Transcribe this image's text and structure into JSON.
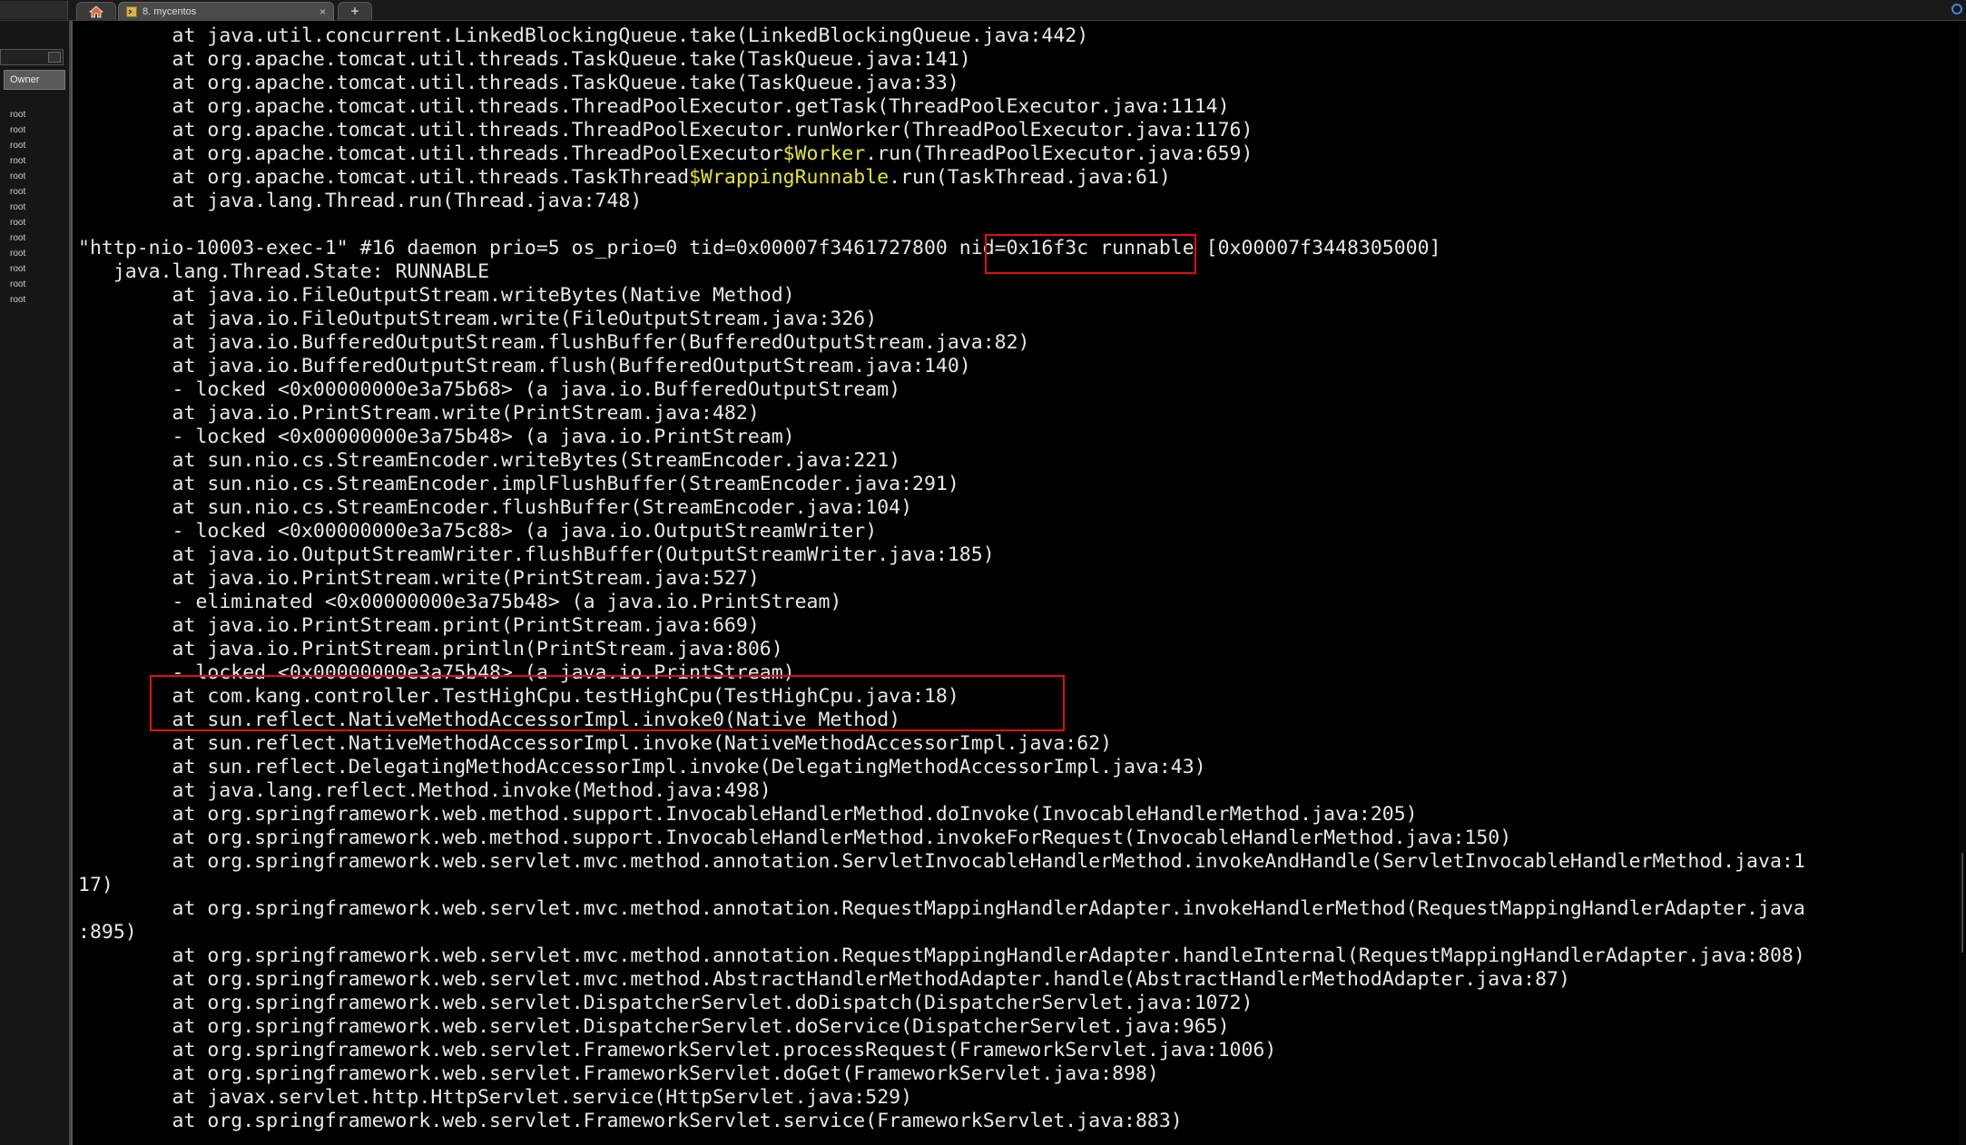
{
  "tabs": {
    "home_icon": "home-icon",
    "session_label": "8. mycentos",
    "session_icon": "terminal-session-icon",
    "close_glyph": "×",
    "new_tab_glyph": "+"
  },
  "sidebar": {
    "column_header": "Owner",
    "rows": [
      "root",
      "root",
      "root",
      "root",
      "root",
      "root",
      "root",
      "root",
      "root",
      "root",
      "root",
      "root",
      "root"
    ]
  },
  "colors": {
    "background": "#000000",
    "text": "#e8e8e8",
    "highlight_text": "#e6e62a",
    "annotation_box": "#e01010"
  },
  "terminal": {
    "lines": [
      {
        "text": "        at java.util.concurrent.LinkedBlockingQueue.take(LinkedBlockingQueue.java:442)"
      },
      {
        "text": "        at org.apache.tomcat.util.threads.TaskQueue.take(TaskQueue.java:141)"
      },
      {
        "text": "        at org.apache.tomcat.util.threads.TaskQueue.take(TaskQueue.java:33)"
      },
      {
        "text": "        at org.apache.tomcat.util.threads.ThreadPoolExecutor.getTask(ThreadPoolExecutor.java:1114)"
      },
      {
        "text": "        at org.apache.tomcat.util.threads.ThreadPoolExecutor.runWorker(ThreadPoolExecutor.java:1176)"
      },
      {
        "before": "        at org.apache.tomcat.util.threads.ThreadPoolExecutor",
        "hl": "$Worker",
        "after": ".run(ThreadPoolExecutor.java:659)"
      },
      {
        "before": "        at org.apache.tomcat.util.threads.TaskThread",
        "hl": "$WrappingRunnable",
        "after": ".run(TaskThread.java:61)"
      },
      {
        "text": "        at java.lang.Thread.run(Thread.java:748)"
      },
      {
        "text": ""
      },
      {
        "text": "\"http-nio-10003-exec-1\" #16 daemon prio=5 os_prio=0 tid=0x00007f3461727800 nid=0x16f3c runnable [0x00007f3448305000]"
      },
      {
        "text": "   java.lang.Thread.State: RUNNABLE"
      },
      {
        "text": "        at java.io.FileOutputStream.writeBytes(Native Method)"
      },
      {
        "text": "        at java.io.FileOutputStream.write(FileOutputStream.java:326)"
      },
      {
        "text": "        at java.io.BufferedOutputStream.flushBuffer(BufferedOutputStream.java:82)"
      },
      {
        "text": "        at java.io.BufferedOutputStream.flush(BufferedOutputStream.java:140)"
      },
      {
        "text": "        - locked <0x00000000e3a75b68> (a java.io.BufferedOutputStream)"
      },
      {
        "text": "        at java.io.PrintStream.write(PrintStream.java:482)"
      },
      {
        "text": "        - locked <0x00000000e3a75b48> (a java.io.PrintStream)"
      },
      {
        "text": "        at sun.nio.cs.StreamEncoder.writeBytes(StreamEncoder.java:221)"
      },
      {
        "text": "        at sun.nio.cs.StreamEncoder.implFlushBuffer(StreamEncoder.java:291)"
      },
      {
        "text": "        at sun.nio.cs.StreamEncoder.flushBuffer(StreamEncoder.java:104)"
      },
      {
        "text": "        - locked <0x00000000e3a75c88> (a java.io.OutputStreamWriter)"
      },
      {
        "text": "        at java.io.OutputStreamWriter.flushBuffer(OutputStreamWriter.java:185)"
      },
      {
        "text": "        at java.io.PrintStream.write(PrintStream.java:527)"
      },
      {
        "text": "        - eliminated <0x00000000e3a75b48> (a java.io.PrintStream)"
      },
      {
        "text": "        at java.io.PrintStream.print(PrintStream.java:669)"
      },
      {
        "text": "        at java.io.PrintStream.println(PrintStream.java:806)"
      },
      {
        "text": "        - locked <0x00000000e3a75b48> (a java.io.PrintStream)"
      },
      {
        "text": "        at com.kang.controller.TestHighCpu.testHighCpu(TestHighCpu.java:18)"
      },
      {
        "text": "        at sun.reflect.NativeMethodAccessorImpl.invoke0(Native Method)"
      },
      {
        "text": "        at sun.reflect.NativeMethodAccessorImpl.invoke(NativeMethodAccessorImpl.java:62)"
      },
      {
        "text": "        at sun.reflect.DelegatingMethodAccessorImpl.invoke(DelegatingMethodAccessorImpl.java:43)"
      },
      {
        "text": "        at java.lang.reflect.Method.invoke(Method.java:498)"
      },
      {
        "text": "        at org.springframework.web.method.support.InvocableHandlerMethod.doInvoke(InvocableHandlerMethod.java:205)"
      },
      {
        "text": "        at org.springframework.web.method.support.InvocableHandlerMethod.invokeForRequest(InvocableHandlerMethod.java:150)"
      },
      {
        "text": "        at org.springframework.web.servlet.mvc.method.annotation.ServletInvocableHandlerMethod.invokeAndHandle(ServletInvocableHandlerMethod.java:1"
      },
      {
        "text": "17)"
      },
      {
        "text": "        at org.springframework.web.servlet.mvc.method.annotation.RequestMappingHandlerAdapter.invokeHandlerMethod(RequestMappingHandlerAdapter.java"
      },
      {
        "text": ":895)"
      },
      {
        "text": "        at org.springframework.web.servlet.mvc.method.annotation.RequestMappingHandlerAdapter.handleInternal(RequestMappingHandlerAdapter.java:808)"
      },
      {
        "text": "        at org.springframework.web.servlet.mvc.method.AbstractHandlerMethodAdapter.handle(AbstractHandlerMethodAdapter.java:87)"
      },
      {
        "text": "        at org.springframework.web.servlet.DispatcherServlet.doDispatch(DispatcherServlet.java:1072)"
      },
      {
        "text": "        at org.springframework.web.servlet.DispatcherServlet.doService(DispatcherServlet.java:965)"
      },
      {
        "text": "        at org.springframework.web.servlet.FrameworkServlet.processRequest(FrameworkServlet.java:1006)"
      },
      {
        "text": "        at org.springframework.web.servlet.FrameworkServlet.doGet(FrameworkServlet.java:898)"
      },
      {
        "text": "        at javax.servlet.http.HttpServlet.service(HttpServlet.java:529)"
      },
      {
        "text": "        at org.springframework.web.servlet.FrameworkServlet.service(FrameworkServlet.java:883)"
      }
    ]
  }
}
